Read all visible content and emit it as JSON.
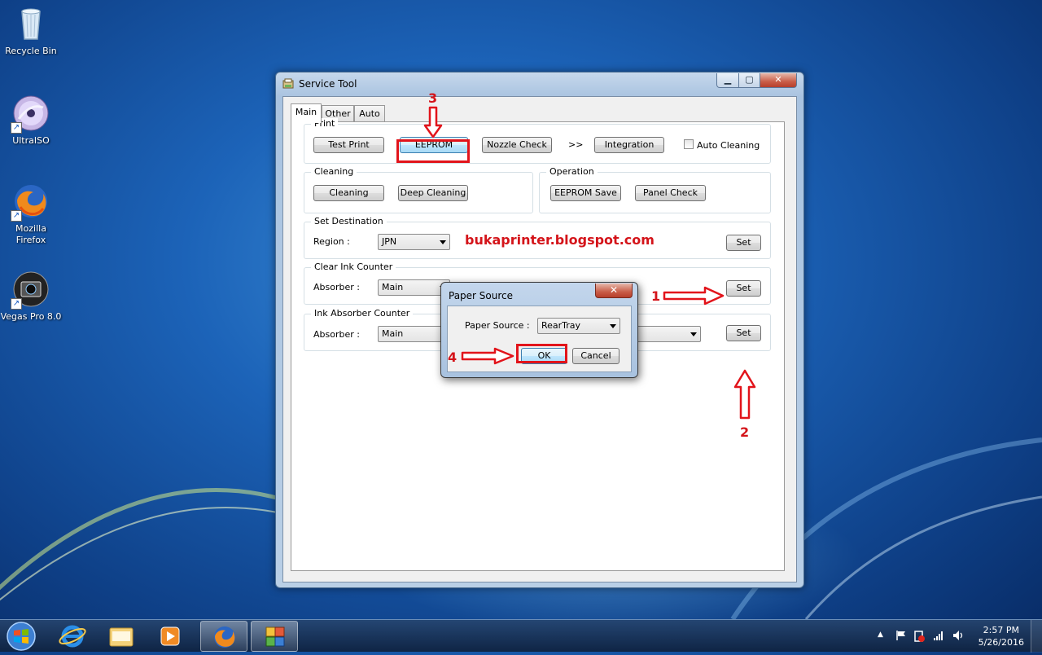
{
  "desktop": {
    "icons": [
      {
        "label": "Recycle Bin"
      },
      {
        "label": "UltraISO"
      },
      {
        "label": "Mozilla Firefox"
      },
      {
        "label": "Vegas Pro 8.0"
      }
    ],
    "watermark": "bukaprinter.blogspot.com"
  },
  "window": {
    "title": "Service Tool",
    "min_label": "▁",
    "max_label": "▢",
    "close_label": "✕",
    "tabs": [
      {
        "label": "Main",
        "active": true
      },
      {
        "label": "Other",
        "active": false
      },
      {
        "label": "Auto",
        "active": false
      }
    ],
    "print": {
      "label": "Print",
      "test_print": "Test Print",
      "eeprom": "EEPROM",
      "nozzle_check": "Nozzle Check",
      "chevrons": ">>",
      "integration": "Integration",
      "auto_cleaning": "Auto Cleaning",
      "auto_cleaning_checked": false
    },
    "cleaning": {
      "label": "Cleaning",
      "cleaning": "Cleaning",
      "deep_cleaning": "Deep Cleaning"
    },
    "operation": {
      "label": "Operation",
      "eeprom_save": "EEPROM Save",
      "panel_check": "Panel Check"
    },
    "set_destination": {
      "label": "Set Destination",
      "region_label": "Region :",
      "region_value": "JPN",
      "set": "Set"
    },
    "clear_ink_counter": {
      "label": "Clear Ink Counter",
      "absorber_label": "Absorber :",
      "absorber_value": "Main",
      "set": "Set"
    },
    "ink_absorber_counter": {
      "label": "Ink Absorber Counter",
      "absorber_label": "Absorber :",
      "absorber_value": "Main",
      "set": "Set"
    }
  },
  "dialog": {
    "title": "Paper Source",
    "close_label": "✕",
    "paper_source_label": "Paper Source :",
    "paper_source_value": "RearTray",
    "ok": "OK",
    "cancel": "Cancel"
  },
  "annotations": {
    "step1": "1",
    "step2": "2",
    "step3": "3",
    "step4": "4",
    "color": "#e2141b"
  },
  "taskbar": {
    "time": "2:57 PM",
    "date": "5/26/2016",
    "tray_up": "▲"
  }
}
